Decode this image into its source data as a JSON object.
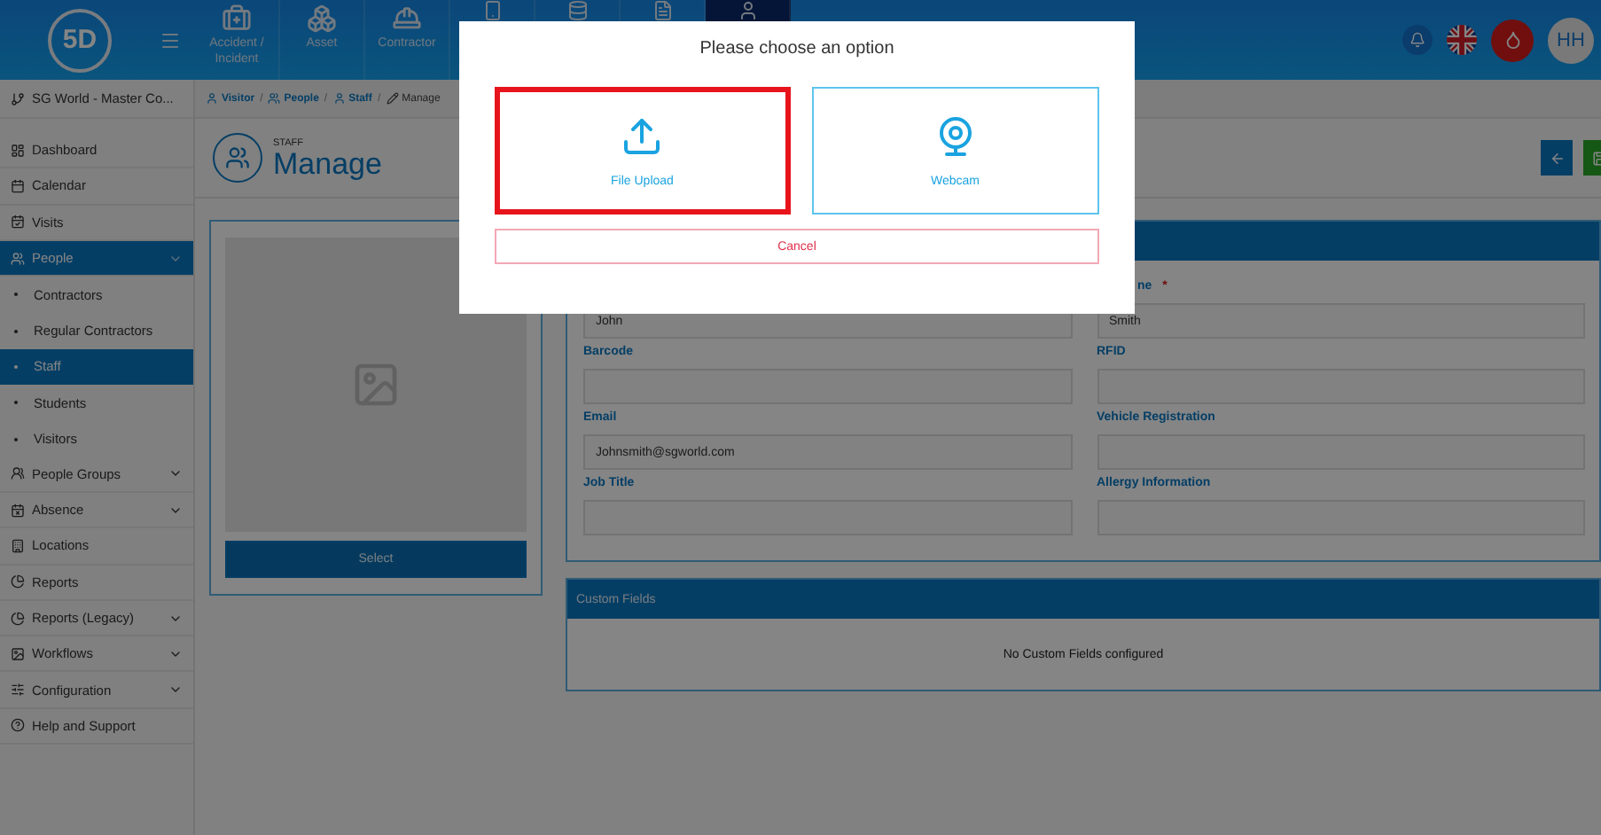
{
  "top_bar": {
    "logo": "5D",
    "nav": [
      {
        "label": "Accident / Incident",
        "selected": false
      },
      {
        "label": "Asset",
        "selected": false
      },
      {
        "label": "Contractor",
        "selected": false
      },
      {
        "selected": false
      },
      {
        "selected": false
      },
      {
        "selected": false
      },
      {
        "selected": true
      }
    ],
    "avatar": "HH"
  },
  "sidebar": {
    "site": "SG World - Master Co...",
    "items": [
      {
        "label": "Dashboard",
        "kind": "link",
        "selected": false
      },
      {
        "label": "Calendar",
        "kind": "link",
        "selected": false
      },
      {
        "label": "Visits",
        "kind": "link",
        "selected": false
      },
      {
        "label": "People",
        "kind": "group",
        "selected": true,
        "expanded": true,
        "children": [
          {
            "label": "Contractors",
            "selected": false
          },
          {
            "label": "Regular Contractors",
            "selected": false
          },
          {
            "label": "Staff",
            "selected": true
          },
          {
            "label": "Students",
            "selected": false
          },
          {
            "label": "Visitors",
            "selected": false
          }
        ]
      },
      {
        "label": "People Groups",
        "kind": "group",
        "selected": false,
        "expanded": false
      },
      {
        "label": "Absence",
        "kind": "group",
        "selected": false,
        "expanded": false
      },
      {
        "label": "Locations",
        "kind": "link",
        "selected": false
      },
      {
        "label": "Reports",
        "kind": "link",
        "selected": false
      },
      {
        "label": "Reports (Legacy)",
        "kind": "group",
        "selected": false,
        "expanded": false
      },
      {
        "label": "Workflows",
        "kind": "group",
        "selected": false,
        "expanded": false
      },
      {
        "label": "Configuration",
        "kind": "group",
        "selected": false,
        "expanded": false
      },
      {
        "label": "Help and Support",
        "kind": "link",
        "selected": false
      }
    ]
  },
  "breadcrumb": [
    {
      "label": "Visitor",
      "separator": "/"
    },
    {
      "label": "People",
      "separator": "/"
    },
    {
      "label": "Staff",
      "separator": "/"
    },
    {
      "label": "Manage"
    }
  ],
  "page_header": {
    "overline": "STAFF",
    "title": "Manage"
  },
  "photo_card": {
    "button": "Select"
  },
  "form": {
    "fields": [
      {
        "value": "John"
      },
      {
        "label": "ne",
        "required_mark": "*",
        "value": "Smith"
      },
      {
        "label": "Barcode"
      },
      {
        "label": "RFID"
      },
      {
        "label": "Email",
        "value": "Johnsmith@sgworld.com"
      },
      {
        "label": "Vehicle Registration"
      },
      {
        "label": "Job Title"
      },
      {
        "label": "Allergy Information"
      }
    ]
  },
  "custom_fields": {
    "title": "Custom Fields",
    "message": "No Custom Fields configured"
  },
  "modal": {
    "title": "Please choose an option",
    "options": [
      {
        "label": "File Upload",
        "kind": "upload",
        "selected": true
      },
      {
        "label": "Webcam",
        "kind": "webcam",
        "selected": false
      }
    ],
    "cancel": "Cancel"
  }
}
